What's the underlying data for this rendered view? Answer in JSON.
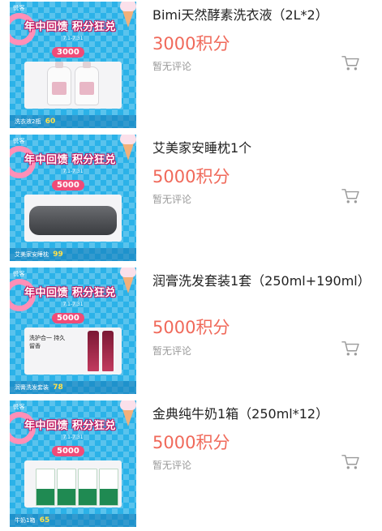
{
  "poster": {
    "brand": "悦客",
    "banner": "年中回馈 积分狂兑",
    "date": "7.1-7.31"
  },
  "items": [
    {
      "title": "Bimi天然酵素洗衣液（2L*2）",
      "price": "3000积分",
      "review": "暂无评论",
      "badge": "3000",
      "footer_name": "洗衣液2瓶",
      "footer_points": "60"
    },
    {
      "title": "艾美家安睡枕1个",
      "price": "5000积分",
      "review": "暂无评论",
      "badge": "5000",
      "footer_name": "艾美家安睡枕",
      "footer_points": "99"
    },
    {
      "title": "润膏洗发套装1套（250ml+190ml）",
      "price": "5000积分",
      "review": "暂无评论",
      "badge": "5000",
      "footer_name": "润膏洗发套装",
      "footer_points": "78",
      "art_text": "洗护合一 持久留香"
    },
    {
      "title": "金典纯牛奶1箱（250ml*12）",
      "price": "5000积分",
      "review": "暂无评论",
      "badge": "5000",
      "footer_name": "牛奶1箱",
      "footer_points": "65"
    }
  ],
  "icons": {
    "cart": "shopping-cart-icon"
  },
  "colors": {
    "price": "#f0695a",
    "poster_bg": "#2bb2e8",
    "badge": "#f04b78"
  }
}
